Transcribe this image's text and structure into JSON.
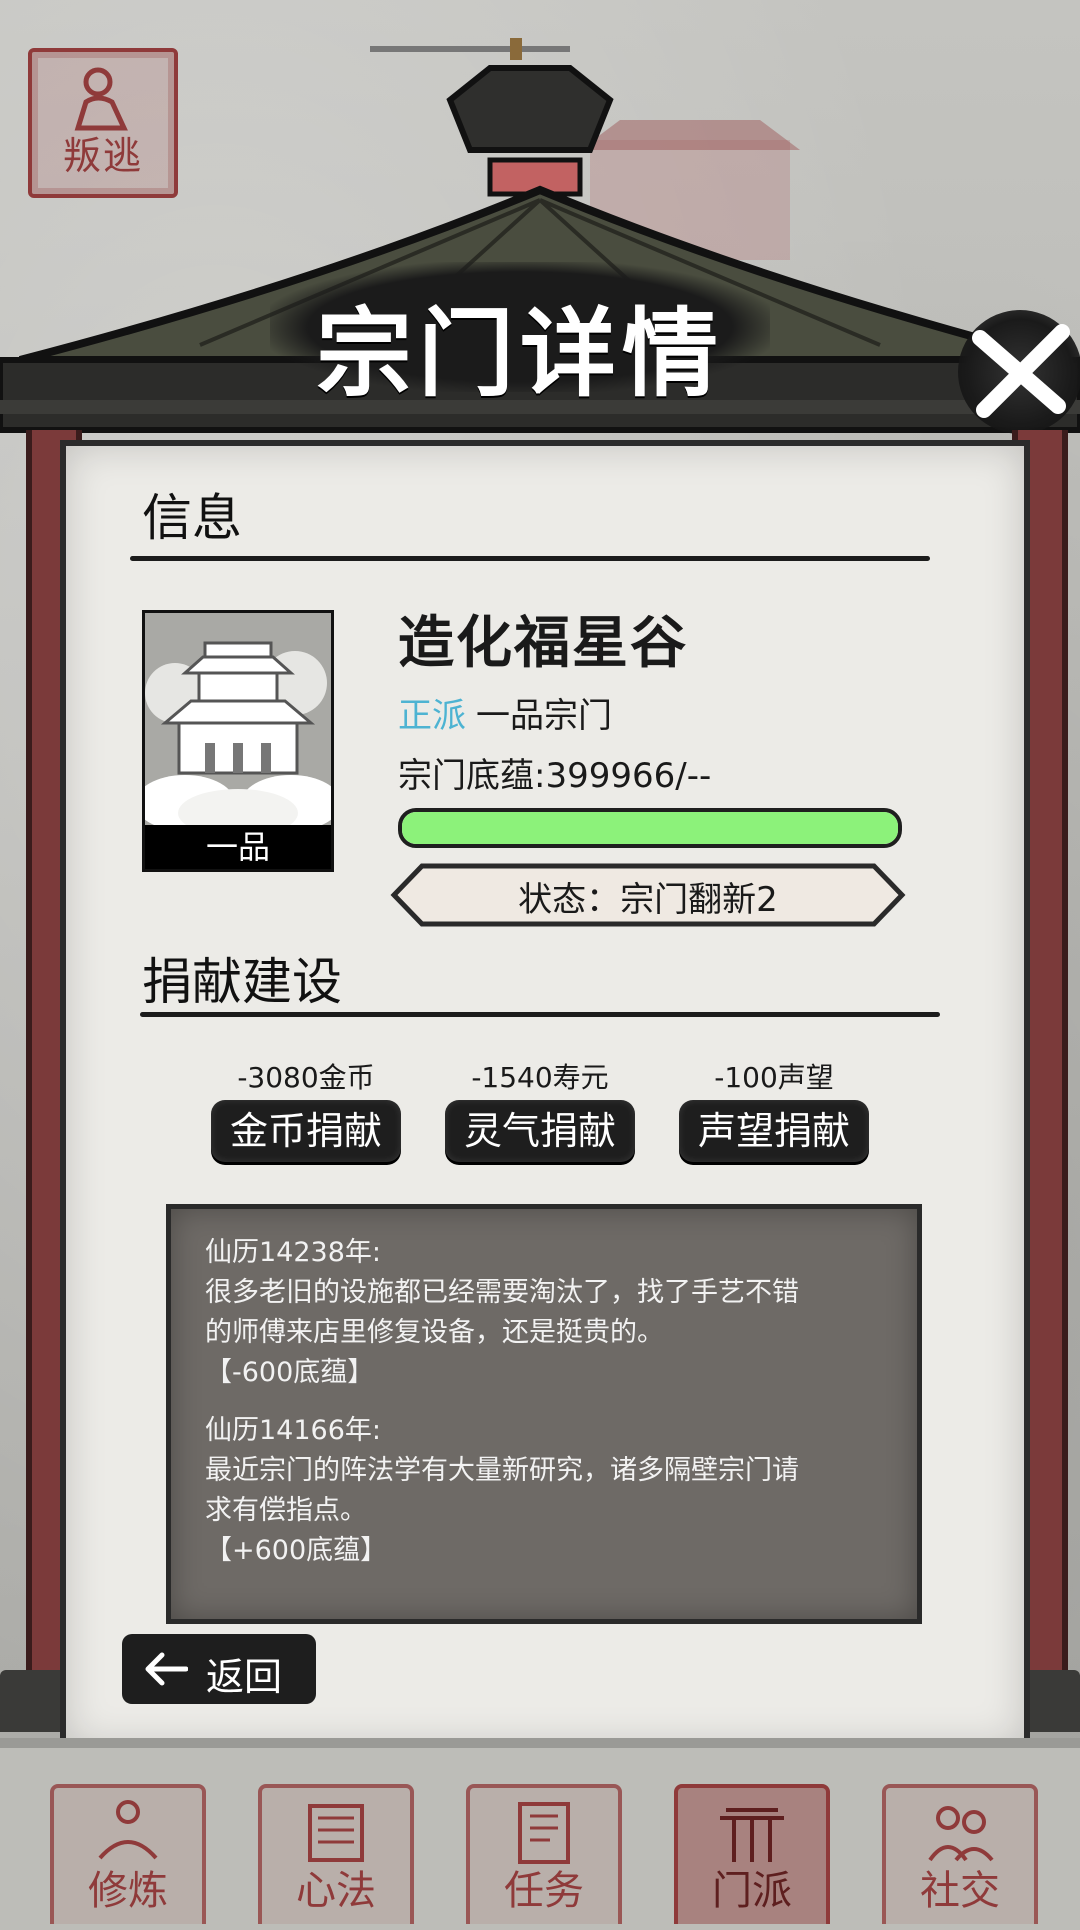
{
  "top_left_seal": {
    "label": "叛逃",
    "icon": "kneeling-figure-icon"
  },
  "window": {
    "title": "宗门详情",
    "close_icon": "close-x-icon"
  },
  "info_section": {
    "heading": "信息",
    "sect": {
      "name": "造化福星谷",
      "grade_badge": "一品",
      "alignment": "正派",
      "rank": "一品宗门",
      "heritage_label": "宗门底蕴:399966/--",
      "heritage_fill": 1.0,
      "status": "状态：宗门翻新2",
      "image_icon": "temple-icon"
    }
  },
  "donate_section": {
    "heading": "捐献建设",
    "options": [
      {
        "cost": "-3080金币",
        "label": "金币捐献"
      },
      {
        "cost": "-1540寿元",
        "label": "灵气捐献"
      },
      {
        "cost": "-100声望",
        "label": "声望捐献"
      }
    ]
  },
  "log": [
    {
      "date": "仙历14238年:",
      "line1": "很多老旧的设施都已经需要淘汰了，找了手艺不错",
      "line2": "的师傅来店里修复设备，还是挺贵的。",
      "effect": "【-600底蕴】"
    },
    {
      "date": "仙历14166年:",
      "line1": "最近宗门的阵法学有大量新研究，诸多隔壁宗门请",
      "line2": "求有偿指点。",
      "effect": "【+600底蕴】"
    }
  ],
  "back_button": {
    "label": "返回",
    "icon": "arrow-left-icon"
  },
  "bottom_nav": [
    {
      "label": "修炼",
      "icon": "meditation-icon",
      "active": false
    },
    {
      "label": "心法",
      "icon": "scroll-icon",
      "active": false
    },
    {
      "label": "任务",
      "icon": "scroll-task-icon",
      "active": false
    },
    {
      "label": "门派",
      "icon": "sect-gate-icon",
      "active": true
    },
    {
      "label": "社交",
      "icon": "people-icon",
      "active": false
    }
  ],
  "colors": {
    "accent_red": "#8f3a3a",
    "alignment_blue": "#4db3d2",
    "progress_green": "#8cf27a",
    "button_dark": "#1e1e1e"
  }
}
